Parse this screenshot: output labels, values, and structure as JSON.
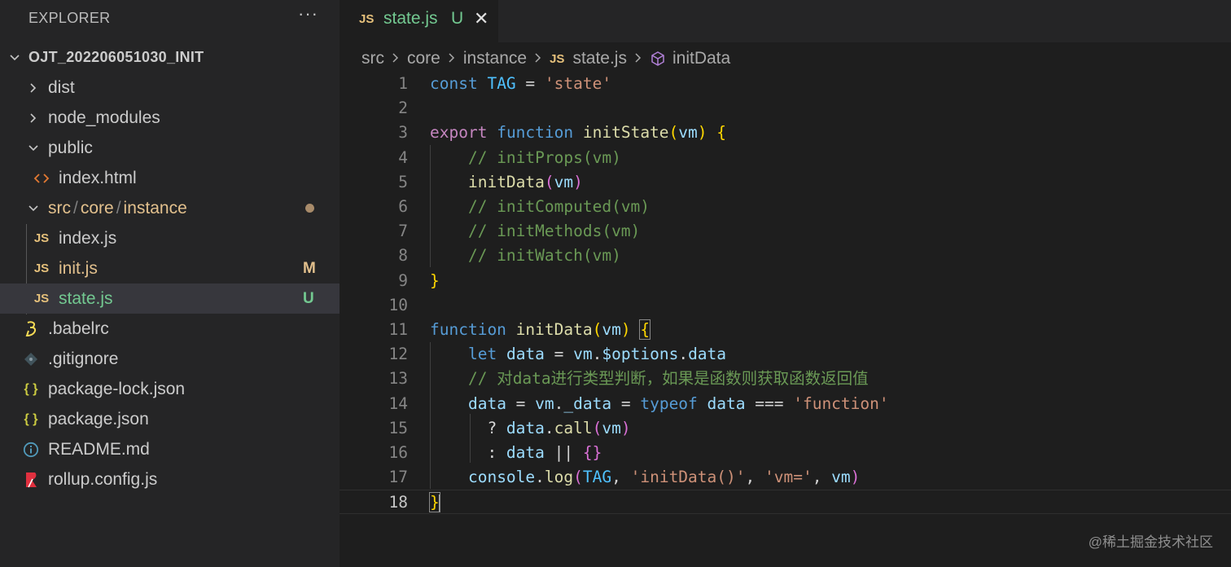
{
  "explorer": {
    "title": "EXPLORER",
    "more_label": "···",
    "root_label": "OJT_202206051030_INIT",
    "items": [
      {
        "label": "dist"
      },
      {
        "label": "node_modules"
      },
      {
        "label": "public"
      },
      {
        "label": "index.html"
      },
      {
        "label_parts": [
          "src",
          "/",
          "core",
          "/",
          "instance"
        ]
      },
      {
        "label": "index.js"
      },
      {
        "label": "init.js",
        "badge": "M"
      },
      {
        "label": "state.js",
        "badge": "U"
      },
      {
        "label": ".babelrc"
      },
      {
        "label": ".gitignore"
      },
      {
        "label": "package-lock.json"
      },
      {
        "label": "package.json"
      },
      {
        "label": "README.md"
      },
      {
        "label": "rollup.config.js"
      }
    ],
    "icons": {
      "js": "JS",
      "json": "{ }"
    }
  },
  "tab": {
    "icon": "JS",
    "label": "state.js",
    "status": "U",
    "close": "✕"
  },
  "breadcrumb": {
    "items": [
      "src",
      "core",
      "instance",
      "state.js",
      "initData"
    ],
    "icon": "JS"
  },
  "editor": {
    "active_line": 18,
    "line_numbers": [
      "1",
      "2",
      "3",
      "4",
      "5",
      "6",
      "7",
      "8",
      "9",
      "10",
      "11",
      "12",
      "13",
      "14",
      "15",
      "16",
      "17",
      "18"
    ],
    "lines": [
      [
        [
          "kw",
          "const"
        ],
        [
          "pl",
          " "
        ],
        [
          "cst",
          "TAG"
        ],
        [
          "pl",
          " = "
        ],
        [
          "str",
          "'state'"
        ]
      ],
      [],
      [
        [
          "kw2",
          "export"
        ],
        [
          "pl",
          " "
        ],
        [
          "kw",
          "function"
        ],
        [
          "pl",
          " "
        ],
        [
          "fn",
          "initState"
        ],
        [
          "br1",
          "("
        ],
        [
          "var",
          "vm"
        ],
        [
          "br1",
          ")"
        ],
        [
          "pl",
          " "
        ],
        [
          "br1",
          "{"
        ]
      ],
      [
        [
          "pl",
          "    "
        ],
        [
          "cm",
          "// initProps(vm)"
        ]
      ],
      [
        [
          "pl",
          "    "
        ],
        [
          "fn",
          "initData"
        ],
        [
          "br2",
          "("
        ],
        [
          "var",
          "vm"
        ],
        [
          "br2",
          ")"
        ]
      ],
      [
        [
          "pl",
          "    "
        ],
        [
          "cm",
          "// initComputed(vm)"
        ]
      ],
      [
        [
          "pl",
          "    "
        ],
        [
          "cm",
          "// initMethods(vm)"
        ]
      ],
      [
        [
          "pl",
          "    "
        ],
        [
          "cm",
          "// initWatch(vm)"
        ]
      ],
      [
        [
          "br1",
          "}"
        ]
      ],
      [],
      [
        [
          "kw",
          "function"
        ],
        [
          "pl",
          " "
        ],
        [
          "fn",
          "initData"
        ],
        [
          "br1",
          "("
        ],
        [
          "var",
          "vm"
        ],
        [
          "br1",
          ")"
        ],
        [
          "pl",
          " "
        ],
        [
          "br1",
          "{"
        ]
      ],
      [
        [
          "pl",
          "    "
        ],
        [
          "kw",
          "let"
        ],
        [
          "pl",
          " "
        ],
        [
          "var",
          "data"
        ],
        [
          "pl",
          " = "
        ],
        [
          "var",
          "vm"
        ],
        [
          "pl",
          "."
        ],
        [
          "var",
          "$options"
        ],
        [
          "pl",
          "."
        ],
        [
          "var",
          "data"
        ]
      ],
      [
        [
          "pl",
          "    "
        ],
        [
          "cm",
          "// 对data进行类型判断，如果是函数则获取函数返回值"
        ]
      ],
      [
        [
          "pl",
          "    "
        ],
        [
          "var",
          "data"
        ],
        [
          "pl",
          " = "
        ],
        [
          "var",
          "vm"
        ],
        [
          "pl",
          "."
        ],
        [
          "var",
          "_data"
        ],
        [
          "pl",
          " = "
        ],
        [
          "kw",
          "typeof"
        ],
        [
          "pl",
          " "
        ],
        [
          "var",
          "data"
        ],
        [
          "pl",
          " === "
        ],
        [
          "str",
          "'function'"
        ]
      ],
      [
        [
          "pl",
          "      ? "
        ],
        [
          "var",
          "data"
        ],
        [
          "pl",
          "."
        ],
        [
          "fn",
          "call"
        ],
        [
          "br2",
          "("
        ],
        [
          "var",
          "vm"
        ],
        [
          "br2",
          ")"
        ]
      ],
      [
        [
          "pl",
          "      : "
        ],
        [
          "var",
          "data"
        ],
        [
          "pl",
          " || "
        ],
        [
          "br2",
          "{}"
        ]
      ],
      [
        [
          "pl",
          "    "
        ],
        [
          "var",
          "console"
        ],
        [
          "pl",
          "."
        ],
        [
          "fn",
          "log"
        ],
        [
          "br2",
          "("
        ],
        [
          "cst",
          "TAG"
        ],
        [
          "pl",
          ", "
        ],
        [
          "str",
          "'initData()'"
        ],
        [
          "pl",
          ", "
        ],
        [
          "str",
          "'vm='"
        ],
        [
          "pl",
          ", "
        ],
        [
          "var",
          "vm"
        ],
        [
          "br2",
          ")"
        ]
      ],
      [
        [
          "br1",
          "}"
        ]
      ]
    ]
  },
  "watermark": "@稀土掘金技术社区"
}
